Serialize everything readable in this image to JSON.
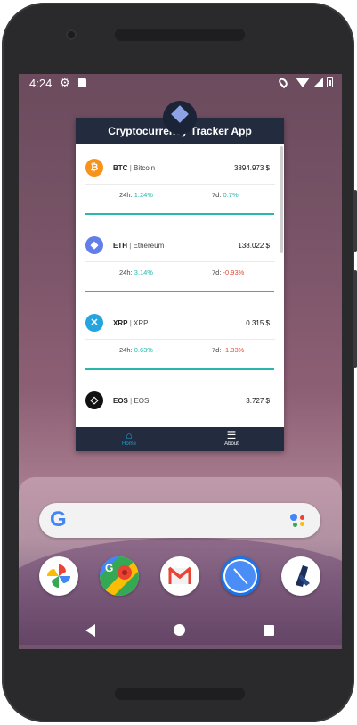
{
  "status_bar": {
    "time": "4:24",
    "icons_left": [
      "settings-icon",
      "sd-card-icon"
    ],
    "icons_right": [
      "location-icon",
      "wifi-icon",
      "signal-icon",
      "battery-icon"
    ]
  },
  "recent_app": {
    "title": "Cryptocurrency Tracker App",
    "header_color": "#232b3e",
    "coins": [
      {
        "symbol": "BTC",
        "name": "Bitcoin",
        "price": "3894.973 $",
        "change_24h_label": "24h:",
        "change_24h": "1.24%",
        "change_24h_dir": "pos",
        "change_7d_label": "7d:",
        "change_7d": "0.7%",
        "change_7d_dir": "pos",
        "logo_color": "#f7931a",
        "logo_icon": "bitcoin-icon"
      },
      {
        "symbol": "ETH",
        "name": "Ethereum",
        "price": "138.022 $",
        "change_24h_label": "24h:",
        "change_24h": "3.14%",
        "change_24h_dir": "pos",
        "change_7d_label": "7d:",
        "change_7d": "-0.93%",
        "change_7d_dir": "neg",
        "logo_color": "#627eea",
        "logo_icon": "ethereum-icon"
      },
      {
        "symbol": "XRP",
        "name": "XRP",
        "price": "0.315 $",
        "change_24h_label": "24h:",
        "change_24h": "0.63%",
        "change_24h_dir": "pos",
        "change_7d_label": "7d:",
        "change_7d": "-1.33%",
        "change_7d_dir": "neg",
        "logo_color": "#23a5e0",
        "logo_icon": "ripple-icon"
      },
      {
        "symbol": "EOS",
        "name": "EOS",
        "price": "3.727 $",
        "change_24h_label": "",
        "change_24h": "",
        "change_24h_dir": "pos",
        "change_7d_label": "",
        "change_7d": "",
        "change_7d_dir": "neg",
        "logo_color": "#111111",
        "logo_icon": "eos-icon"
      }
    ],
    "bottom_nav": [
      {
        "label": "Home",
        "icon": "home-icon",
        "active": true
      },
      {
        "label": "About",
        "icon": "sliders-icon",
        "active": false
      }
    ],
    "accent_color": "#2ab6ab"
  },
  "home_screen": {
    "search_logo": "G",
    "dock_apps": [
      "google-photos-icon",
      "google-maps-icon",
      "gmail-icon",
      "clock-icon",
      "app-icon"
    ]
  },
  "nav_buttons": [
    "back-icon",
    "home-button-icon",
    "recents-icon"
  ]
}
